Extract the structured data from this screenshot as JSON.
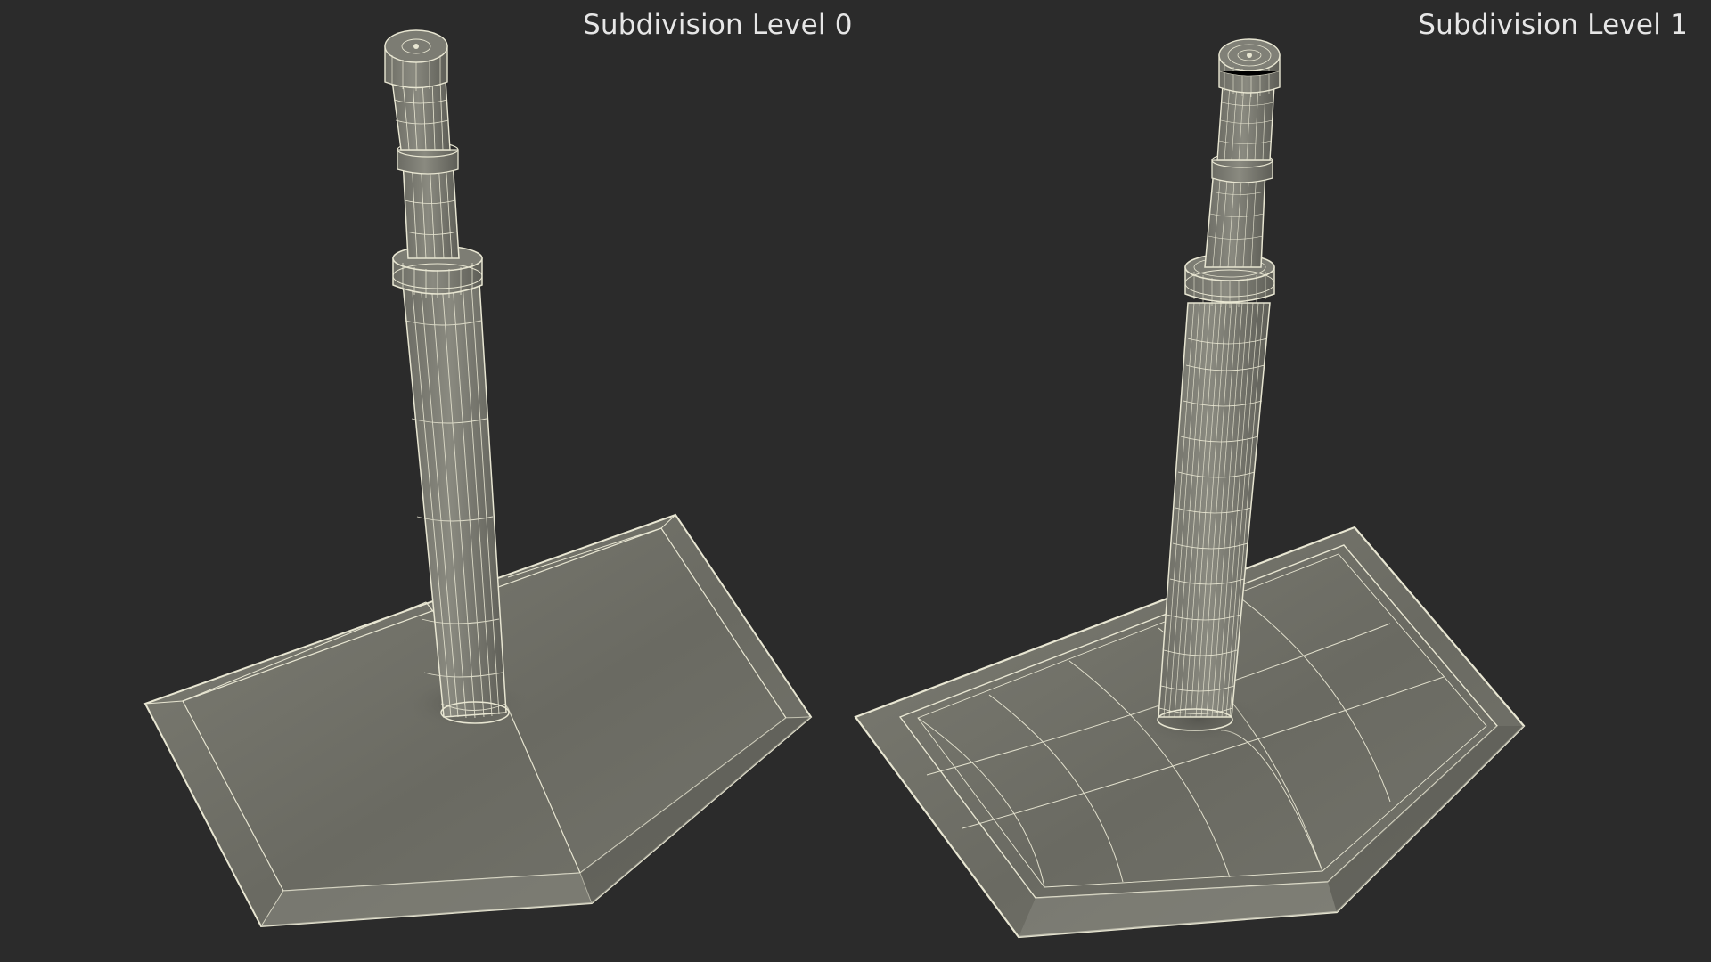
{
  "panels": [
    {
      "label": "Subdivision Level 0"
    },
    {
      "label": "Subdivision Level 1"
    }
  ],
  "colors": {
    "background": "#2b2b2b",
    "surface": "#7a7a70",
    "wire": "#e8e6d2",
    "label": "#e6e6e6"
  }
}
